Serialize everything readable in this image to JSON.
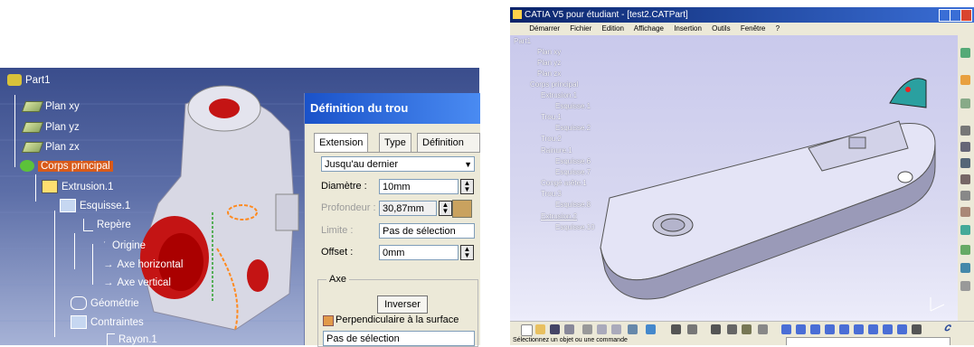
{
  "left": {
    "tree": {
      "root": "Part1",
      "plan_xy": "Plan xy",
      "plan_yz": "Plan yz",
      "plan_zx": "Plan zx",
      "corps": "Corps principal",
      "extrusion": "Extrusion.1",
      "esquisse": "Esquisse.1",
      "repere": "Repère",
      "origine": "Origine",
      "axe_h": "Axe horizontal",
      "axe_v": "Axe vertical",
      "geometrie": "Géométrie",
      "contraintes": "Contraintes",
      "rayon": "Rayon.1"
    },
    "dialog": {
      "title": "Définition du trou",
      "tabs": [
        "Extension",
        "Type",
        "Définition du"
      ],
      "limit_type": "Jusqu'au dernier",
      "diametre_label": "Diamètre :",
      "diametre_value": "10mm",
      "profondeur_label": "Profondeur :",
      "profondeur_value": "30,87mm",
      "limite_label": "Limite :",
      "limite_value": "Pas de sélection",
      "offset_label": "Offset :",
      "offset_value": "0mm",
      "axe_group": "Axe",
      "inverser": "Inverser",
      "perpendiculaire": "Perpendiculaire à la surface",
      "selection": "Pas de sélection"
    }
  },
  "right": {
    "title": "CATIA V5 pour étudiant - [test2.CATPart]",
    "menu": [
      "Démarrer",
      "Fichier",
      "Edition",
      "Affichage",
      "Insertion",
      "Outils",
      "Fenêtre",
      "?"
    ],
    "tree": [
      "Part1",
      "Plan xy",
      "Plan yz",
      "Plan zx",
      "Corps principal",
      "Extrusion.1",
      "Esquisse.1",
      "Trou.1",
      "Esquisse.2",
      "Trou.2",
      "Rainure.1",
      "Esquisse.6",
      "Esquisse.7",
      "Congé arête.1",
      "Trou.3",
      "Esquisse.8",
      "Extrusion.2",
      "Esquisse.10"
    ],
    "status": "Sélectionnez un objet ou une commande"
  }
}
